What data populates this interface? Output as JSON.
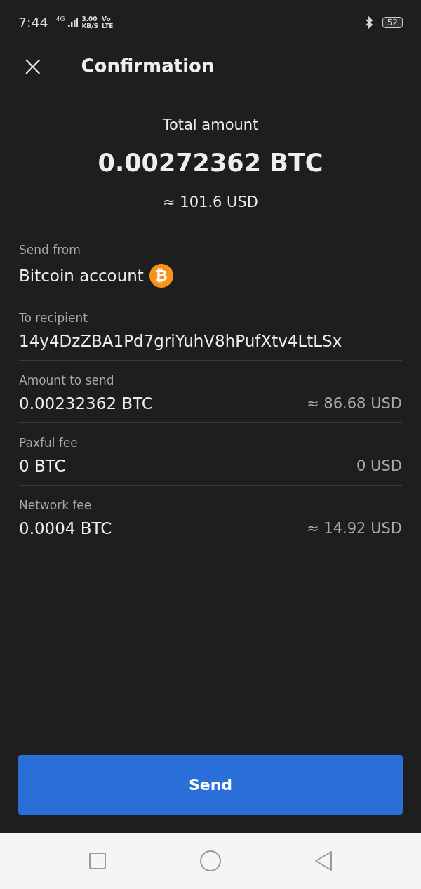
{
  "status_bar": {
    "time": "7:44",
    "network": "4G",
    "speed": "3.00",
    "speed_unit": "KB/S",
    "volte_top": "Vo",
    "volte_bottom": "LTE",
    "battery": "52"
  },
  "header": {
    "close_icon": "×",
    "title": "Confirmation"
  },
  "total": {
    "label": "Total amount",
    "amount": "0.00272362 BTC",
    "fiat": "≈ 101.6 USD"
  },
  "details": [
    {
      "label": "Send from",
      "value": "Bitcoin account",
      "coin_symbol": "₿"
    },
    {
      "label": "To recipient",
      "value": "14y4DzZBA1Pd7griYuhV8hPufXtv4LtLSx"
    },
    {
      "label": "Amount to send",
      "value": "0.00232362 BTC",
      "fiat": "≈ 86.68 USD"
    },
    {
      "label": "Paxful fee",
      "value": "0 BTC",
      "fiat": "0 USD"
    },
    {
      "label": "Network fee",
      "value": "0.0004 BTC",
      "fiat": "≈ 14.92 USD"
    }
  ],
  "send_button": "Send"
}
